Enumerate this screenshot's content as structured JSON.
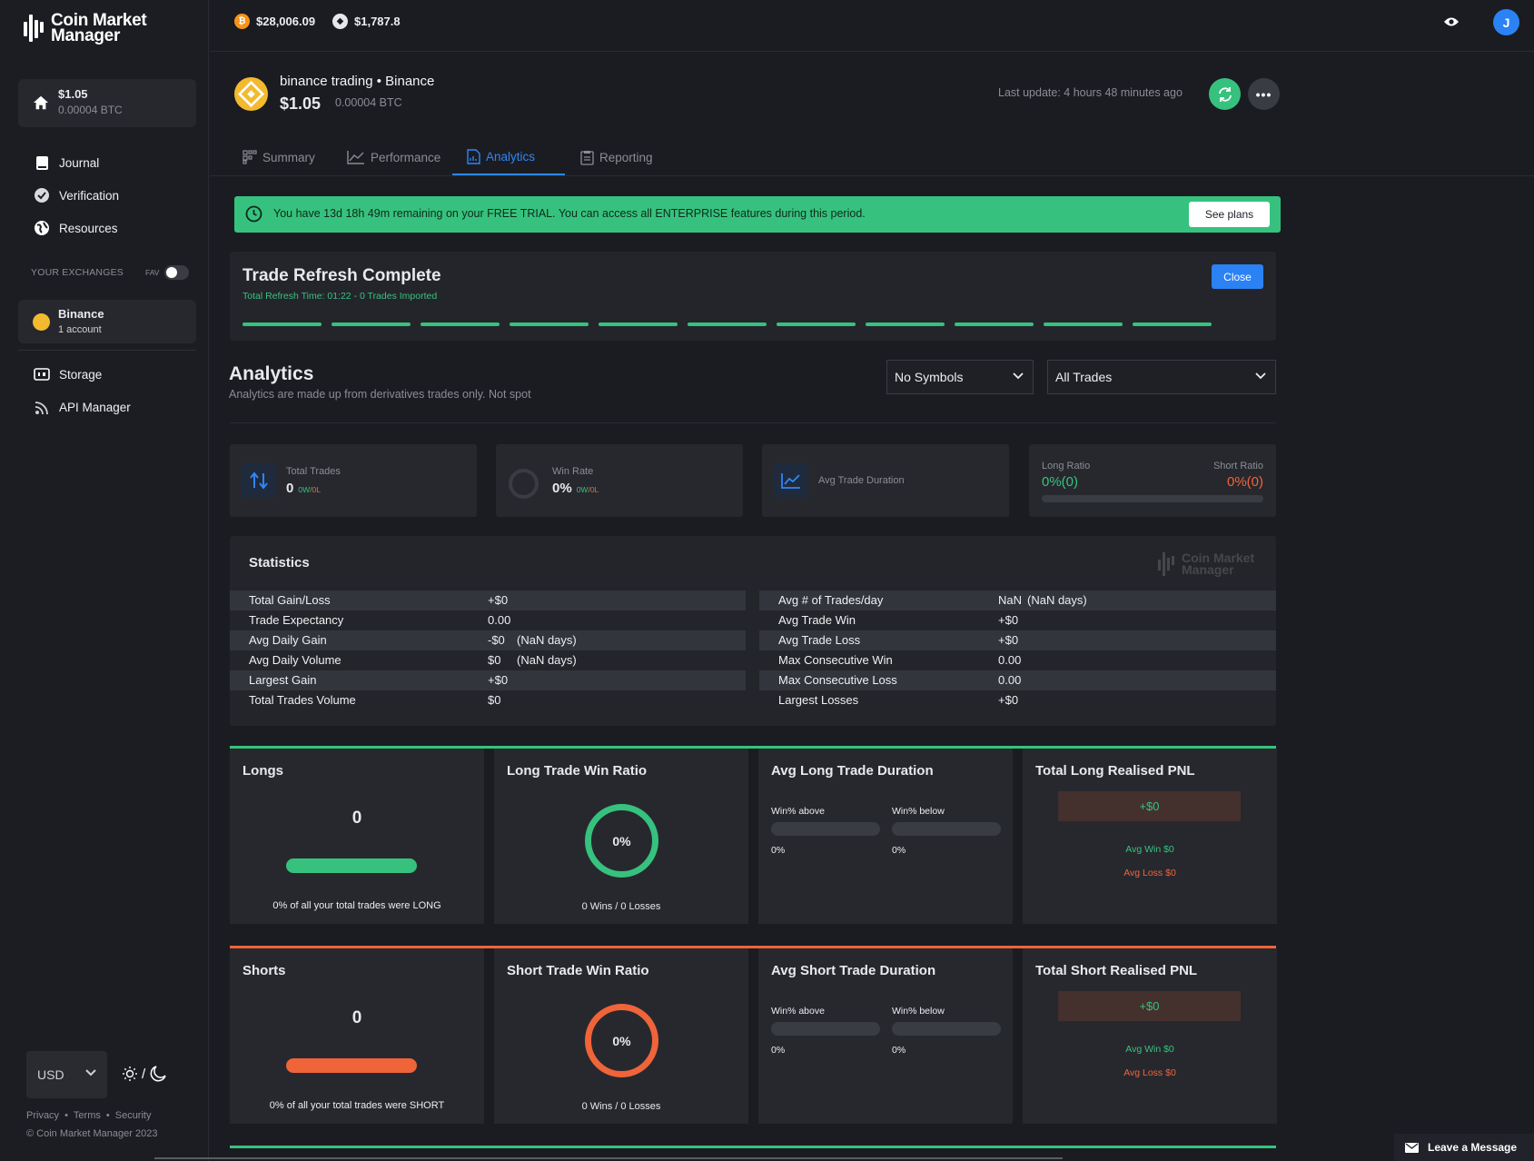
{
  "brand": {
    "line1": "Coin Market",
    "line2": "Manager"
  },
  "sidebar": {
    "balance": "$1.05",
    "balance_btc": "0.00004 BTC",
    "nav": [
      {
        "label": "Journal",
        "icon": "book-icon"
      },
      {
        "label": "Verification",
        "icon": "check-circle-icon"
      },
      {
        "label": "Resources",
        "icon": "globe-icon"
      }
    ],
    "exchanges_label": "YOUR EXCHANGES",
    "fav_label": "FAV",
    "exchange": {
      "name": "Binance",
      "accounts": "1 account"
    },
    "nav2": [
      {
        "label": "Storage",
        "icon": "storage-icon"
      },
      {
        "label": "API Manager",
        "icon": "rss-icon"
      }
    ],
    "currency": "USD",
    "theme_sep": "/",
    "footer": {
      "privacy": "Privacy",
      "terms": "Terms",
      "security": "Security",
      "copyright": "© Coin Market Manager 2023"
    }
  },
  "topbar": {
    "btc_price": "$28,006.09",
    "eth_price": "$1,787.8",
    "avatar_initial": "J"
  },
  "account": {
    "title": "binance trading • Binance",
    "balance": "$1.05",
    "balance_btc": "0.00004 BTC",
    "last_update": "Last update: 4 hours 48 minutes ago"
  },
  "tabs": [
    {
      "label": "Summary",
      "icon": "grid-icon"
    },
    {
      "label": "Performance",
      "icon": "line-chart-icon"
    },
    {
      "label": "Analytics",
      "icon": "document-chart-icon",
      "active": true
    },
    {
      "label": "Reporting",
      "icon": "clipboard-icon"
    }
  ],
  "trial": {
    "message": "You have 13d 18h 49m remaining on your FREE TRIAL. You can access all ENTERPRISE features during this period.",
    "button": "See plans"
  },
  "refresh": {
    "title": "Trade Refresh Complete",
    "subtitle": "Total Refresh Time: 01:22 - 0 Trades Imported",
    "close": "Close",
    "progress": 1.0
  },
  "analytics": {
    "title": "Analytics",
    "subtitle": "Analytics are made up from derivatives trades only. Not spot",
    "symbol_select": "No Symbols",
    "trade_select": "All Trades"
  },
  "summary_cards": {
    "total_trades": {
      "label": "Total Trades",
      "value": "0",
      "wins": "0W",
      "sep": "/",
      "losses": "0L"
    },
    "win_rate": {
      "label": "Win Rate",
      "value": "0%",
      "wins": "0W",
      "sep": "/",
      "losses": "0L"
    },
    "avg_duration": {
      "label": "Avg Trade Duration"
    },
    "ratio": {
      "long_label": "Long Ratio",
      "long_value": "0%(0)",
      "short_label": "Short Ratio",
      "short_value": "0%(0)"
    }
  },
  "statistics": {
    "title": "Statistics",
    "left": [
      {
        "key": "Total Gain/Loss",
        "value": "+$0",
        "tone": "g",
        "extra": ""
      },
      {
        "key": "Trade Expectancy",
        "value": "0.00",
        "tone": "",
        "extra": ""
      },
      {
        "key": "Avg Daily Gain",
        "value": "-$0",
        "tone": "r",
        "extra": "(NaN days)"
      },
      {
        "key": "Avg Daily Volume",
        "value": "$0",
        "tone": "",
        "extra": "(NaN days)"
      },
      {
        "key": "Largest Gain",
        "value": "+$0",
        "tone": "g",
        "extra": ""
      },
      {
        "key": "Total Trades Volume",
        "value": "$0",
        "tone": "",
        "extra": ""
      }
    ],
    "right": [
      {
        "key": "Avg # of Trades/day",
        "value": "NaN",
        "tone": "",
        "extra": "(NaN days)"
      },
      {
        "key": "Avg Trade Win",
        "value": "+$0",
        "tone": "g",
        "extra": ""
      },
      {
        "key": "Avg Trade Loss",
        "value": "+$0",
        "tone": "g",
        "extra": ""
      },
      {
        "key": "Max Consecutive Win",
        "value": "0.00",
        "tone": "",
        "extra": ""
      },
      {
        "key": "Max Consecutive Loss",
        "value": "0.00",
        "tone": "",
        "extra": ""
      },
      {
        "key": "Largest Losses",
        "value": "+$0",
        "tone": "g",
        "extra": ""
      }
    ]
  },
  "longs": {
    "title": "Longs",
    "count": "0",
    "note": "0% of all your total trades were LONG",
    "win_ratio_title": "Long Trade Win Ratio",
    "win_ratio": "0%",
    "wins_losses": "0 Wins / 0 Losses",
    "duration_title": "Avg Long Trade Duration",
    "above_label": "Win% above",
    "below_label": "Win% below",
    "above": "0%",
    "below": "0%",
    "pnl_title": "Total Long Realised PNL",
    "pnl": "+$0",
    "avg_win": "Avg Win $0",
    "avg_loss": "Avg Loss $0"
  },
  "shorts": {
    "title": "Shorts",
    "count": "0",
    "note": "0% of all your total trades were SHORT",
    "win_ratio_title": "Short Trade Win Ratio",
    "win_ratio": "0%",
    "wins_losses": "0 Wins / 0 Losses",
    "duration_title": "Avg Short Trade Duration",
    "above_label": "Win% above",
    "below_label": "Win% below",
    "above": "0%",
    "below": "0%",
    "pnl_title": "Total Short Realised PNL",
    "pnl": "+$0",
    "avg_win": "Avg Win $0",
    "avg_loss": "Avg Loss $0"
  },
  "chat": {
    "label": "Leave a Message"
  },
  "colors": {
    "green": "#36c27e",
    "red": "#f0643a",
    "blue": "#2e86f7",
    "binance": "#f3ba2f"
  }
}
